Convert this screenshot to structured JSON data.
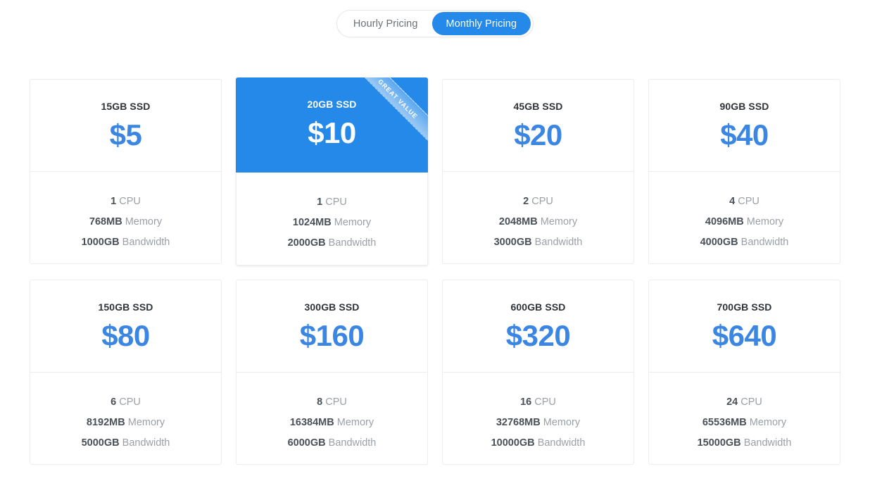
{
  "billing_toggle": {
    "options": [
      {
        "label": "Hourly Pricing",
        "active": false
      },
      {
        "label": "Monthly Pricing",
        "active": true
      }
    ]
  },
  "colors": {
    "accent_blue": "#2489e8",
    "price_blue": "#3b86e2",
    "ribbon_blue_light": "#9cc9f4",
    "title_dark": "#2f3337",
    "spec_value": "#4a5058",
    "spec_label": "#9ba0a6",
    "card_border": "#ededed",
    "page_background": "#ffffff"
  },
  "ribbon": {
    "label": "GREAT VALUE"
  },
  "spec_labels": {
    "cpu": "CPU",
    "memory": "Memory",
    "bandwidth": "Bandwidth"
  },
  "plans": [
    {
      "title": "15GB SSD",
      "price": "$5",
      "cpu_value": "1",
      "cpu_label": "CPU",
      "memory_value": "768MB",
      "memory_label": "Memory",
      "bandwidth_value": "1000GB",
      "bandwidth_label": "Bandwidth",
      "featured": false
    },
    {
      "title": "20GB SSD",
      "price": "$10",
      "cpu_value": "1",
      "cpu_label": "CPU",
      "memory_value": "1024MB",
      "memory_label": "Memory",
      "bandwidth_value": "2000GB",
      "bandwidth_label": "Bandwidth",
      "featured": true,
      "badge": "GREAT VALUE"
    },
    {
      "title": "45GB SSD",
      "price": "$20",
      "cpu_value": "2",
      "cpu_label": "CPU",
      "memory_value": "2048MB",
      "memory_label": "Memory",
      "bandwidth_value": "3000GB",
      "bandwidth_label": "Bandwidth",
      "featured": false
    },
    {
      "title": "90GB SSD",
      "price": "$40",
      "cpu_value": "4",
      "cpu_label": "CPU",
      "memory_value": "4096MB",
      "memory_label": "Memory",
      "bandwidth_value": "4000GB",
      "bandwidth_label": "Bandwidth",
      "featured": false
    },
    {
      "title": "150GB SSD",
      "price": "$80",
      "cpu_value": "6",
      "cpu_label": "CPU",
      "memory_value": "8192MB",
      "memory_label": "Memory",
      "bandwidth_value": "5000GB",
      "bandwidth_label": "Bandwidth",
      "featured": false
    },
    {
      "title": "300GB SSD",
      "price": "$160",
      "cpu_value": "8",
      "cpu_label": "CPU",
      "memory_value": "16384MB",
      "memory_label": "Memory",
      "bandwidth_value": "6000GB",
      "bandwidth_label": "Bandwidth",
      "featured": false
    },
    {
      "title": "600GB SSD",
      "price": "$320",
      "cpu_value": "16",
      "cpu_label": "CPU",
      "memory_value": "32768MB",
      "memory_label": "Memory",
      "bandwidth_value": "10000GB",
      "bandwidth_label": "Bandwidth",
      "featured": false
    },
    {
      "title": "700GB SSD",
      "price": "$640",
      "cpu_value": "24",
      "cpu_label": "CPU",
      "memory_value": "65536MB",
      "memory_label": "Memory",
      "bandwidth_value": "15000GB",
      "bandwidth_label": "Bandwidth",
      "featured": false
    }
  ]
}
